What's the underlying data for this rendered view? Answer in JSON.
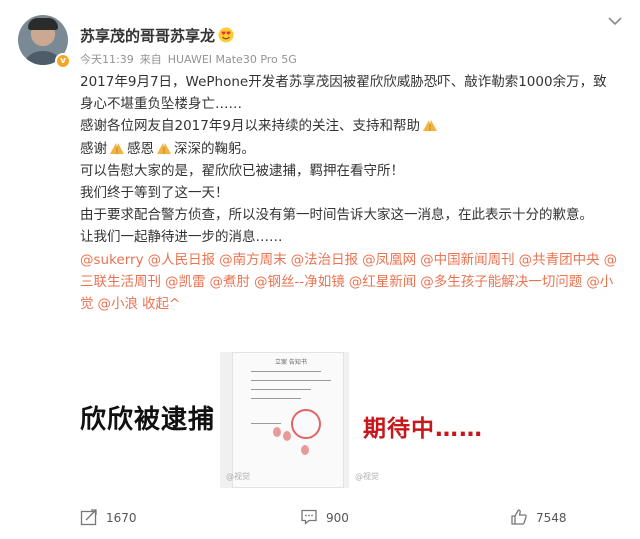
{
  "post": {
    "username": "苏享茂的哥哥苏享龙",
    "time": "今天11:39",
    "source_prefix": "来自",
    "source_device": "HUAWEI Mate30 Pro 5G",
    "verified_badge": "v",
    "lines": [
      "2017年9月7日，WePhone开发者苏享茂因被翟欣欣威胁恐吓、敲诈勒索1000余万，致",
      "身心不堪重负坠楼身亡……",
      "感谢各位网友自2017年9月以来持续的关注、支持和帮助",
      "感谢",
      "感恩",
      "深深的鞠躬。",
      "可以告慰大家的是，翟欣欣已被逮捕，羁押在看守所！",
      "我们终于等到了这一天！",
      "由于要求配合警方侦查，所以没有第一时间告诉大家这一消息，在此表示十分的歉意。",
      "让我们一起静待进一步的消息……"
    ],
    "mentions": [
      "@sukerry",
      "@人民日报",
      "@南方周末",
      "@法治日报",
      "@凤凰网",
      "@中国新闻周刊",
      "@共青团中央",
      "@三联生活周刊",
      "@凯雷",
      "@煮肘",
      "@钢丝--净如镜",
      "@红星新闻",
      "@多生孩子能解决一切问题",
      "@小觉",
      "@小浪"
    ],
    "collapse_label": "收起^",
    "images": [
      {
        "text": "欣欣被逮捕",
        "icon": "text-image"
      },
      {
        "title": "立案 告知书",
        "icon": "document-photo"
      },
      {
        "text": "期待中……",
        "icon": "text-image"
      }
    ],
    "watermark": "@视觉"
  },
  "footer": {
    "share_count": "1670",
    "comment_count": "900",
    "like_count": "7548"
  },
  "colors": {
    "link": "#eb7350",
    "badge": "#f6a623",
    "meta": "#939393",
    "red_text": "#c8161d"
  }
}
